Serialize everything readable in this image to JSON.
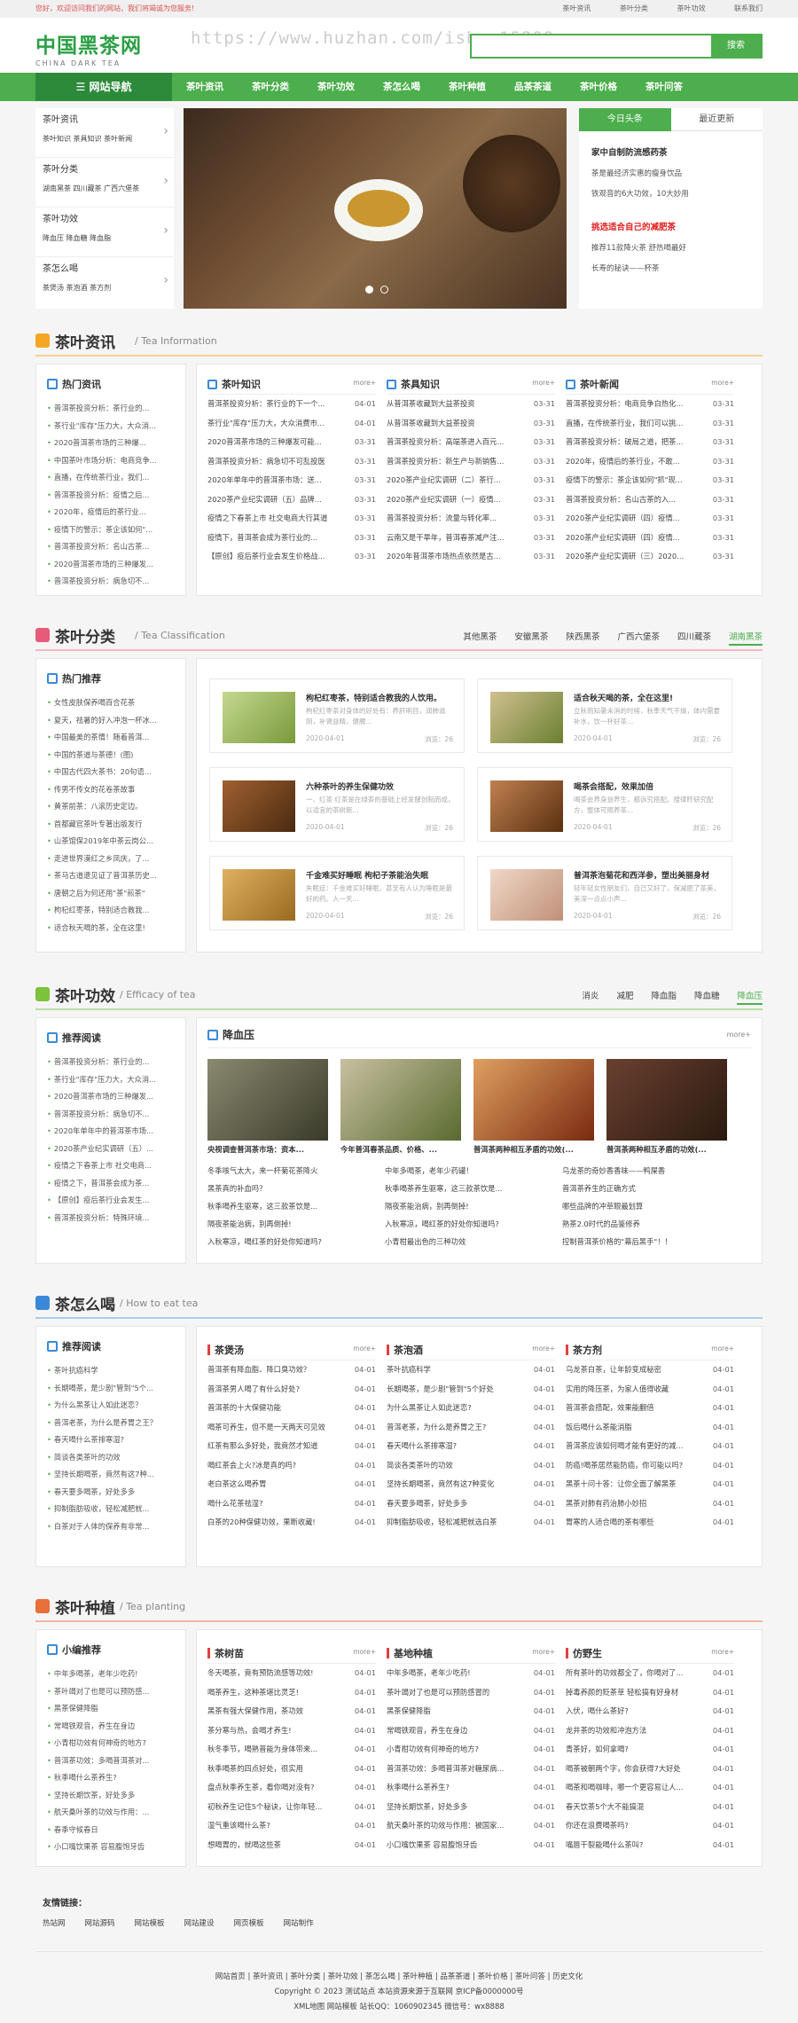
{
  "topbar": {
    "welcome": "您好，欢迎访问我们的网站，我们将竭诚为您服务!",
    "links": [
      "茶叶资讯",
      "茶叶分类",
      "茶叶功效",
      "联系我们"
    ]
  },
  "logo": {
    "title": "中国黑茶网",
    "subtitle": "CHINA DARK TEA"
  },
  "watermark": "https://www.huzhan.com/ishop15299",
  "search": {
    "button": "搜索",
    "placeholder": ""
  },
  "nav": {
    "home": "网站导航",
    "items": [
      "茶叶资讯",
      "茶叶分类",
      "茶叶功效",
      "茶怎么喝",
      "茶叶种植",
      "品茶茶道",
      "茶叶价格",
      "茶叶问答"
    ]
  },
  "categories": [
    {
      "title": "茶叶资讯",
      "sub": "茶叶知识  茶具知识  茶叶新闻"
    },
    {
      "title": "茶叶分类",
      "sub": "湖南黑茶  四川藏茶  广西六堡茶"
    },
    {
      "title": "茶叶功效",
      "sub": "降血压  降血糖  降血脂"
    },
    {
      "title": "茶怎么喝",
      "sub": "茶煲汤  茶泡酒  茶方剂"
    }
  ],
  "newsbox": {
    "tabs": [
      "今日头条",
      "最近更新"
    ],
    "headline1": "家中自制防流感药茶",
    "items1": [
      "茶是最经济实惠的瘦身饮品",
      "铁观音的6大功效，10大妙用"
    ],
    "headline2": "挑选适合自己的减肥茶",
    "items2": [
      "推荐11款降火茶 舒热喝最好",
      "长寿的秘诀——杯茶"
    ]
  },
  "s1": {
    "name": "茶叶资讯",
    "en": "/ Tea Information",
    "side_title": "热门资讯",
    "side": [
      "普洱茶投资分析：茶行业的...",
      "茶行业\"库存\"压力大，大众消...",
      "2020普洱茶市场的三种爆...",
      "中国茶叶市场分析：电商竞争...",
      "直播，在传统茶行业，我们...",
      "普洱茶投资分析：疫情之后...",
      "2020年，疫情后的茶行业...",
      "疫情下的警示：茶企该如何\"...",
      "普洱茶投资分析：名山古茶...",
      "2020普洱茶市场的三种爆发...",
      "普洱茶投资分析：病急切不..."
    ],
    "cols": [
      {
        "title": "茶叶知识",
        "more": "more+",
        "rows": [
          [
            "普洱茶投资分析：茶行业的下一个...",
            "04-01"
          ],
          [
            "茶行业\"库存\"压力大，大众消费市...",
            "04-01"
          ],
          [
            "2020普洱茶市场的三种爆发可能...",
            "03-31"
          ],
          [
            "普洱茶投资分析：病急切不可乱投医",
            "03-31"
          ],
          [
            "2020年单年中的普洱茶市场：送...",
            "03-31"
          ],
          [
            "2020茶产业纪实调研（五）品牌...",
            "03-31"
          ],
          [
            "疫情之下春茶上市 社交电商大行其道",
            "03-31"
          ],
          [
            "疫情下，普洱茶会成为茶行业的...",
            "03-31"
          ],
          [
            "【原创】疫后茶行业会发生价格战...",
            "03-31"
          ]
        ]
      },
      {
        "title": "茶具知识",
        "more": "more+",
        "rows": [
          [
            "从普洱茶收藏到大益茶投资",
            "03-31"
          ],
          [
            "从普洱茶收藏到大益茶投资",
            "03-31"
          ],
          [
            "普洱茶投资分析：高端茶进入百元...",
            "03-31"
          ],
          [
            "普洱茶投资分析：新生产与新销售...",
            "03-31"
          ],
          [
            "2020茶产业纪实调研（二）茶行...",
            "03-31"
          ],
          [
            "2020茶产业纪实调研（一）疫情...",
            "03-31"
          ],
          [
            "普洱茶投资分析：流量与转化率...",
            "03-31"
          ],
          [
            "云南又是干旱年，普洱春茶减产注...",
            "03-31"
          ],
          [
            "2020年普洱茶市场热点依然是古...",
            "03-31"
          ]
        ]
      },
      {
        "title": "茶叶新闻",
        "more": "more+",
        "rows": [
          [
            "普洱茶投资分析：电商竞争白热化...",
            "03-31"
          ],
          [
            "直播，在传统茶行业，我们可以挑...",
            "03-31"
          ],
          [
            "普洱茶投资分析：破局之道，把茶...",
            "03-31"
          ],
          [
            "2020年，疫情后的茶行业，不敢...",
            "03-31"
          ],
          [
            "疫情下的警示：茶企该如何\"抓\"现...",
            "03-31"
          ],
          [
            "普洱茶投资分析：名山古茶的入...",
            "03-31"
          ],
          [
            "2020茶产业纪实调研（四）疫情...",
            "03-31"
          ],
          [
            "2020茶产业纪实调研（四）疫情...",
            "03-31"
          ],
          [
            "2020茶产业纪实调研（三）2020...",
            "03-31"
          ]
        ]
      }
    ]
  },
  "s2": {
    "name": "茶叶分类",
    "en": "/ Tea Classification",
    "tabs": [
      "其他黑茶",
      "安徽黑茶",
      "陕西黑茶",
      "广西六堡茶",
      "四川藏茶",
      "湖南黑茶"
    ],
    "side_title": "热门推荐",
    "side": [
      "女性皮肤保养喝百合花茶",
      "夏天，祛暑的好入冲泡一杯冰...",
      "中国最美的茶情！随着普洱...",
      "中国的茶道与茶德！(图)",
      "中国古代四大茶书：20句语...",
      "传男不传女的花卷茶故事",
      "黄茶前茶：八滚历史定边。",
      "首都藏官茶叶专著出版发行",
      "山茶馆保2019年中茶云岗公...",
      "走进世界漠红之乡凤庆，了...",
      "茶马古道遗见证了普洱茶历史...",
      "唐朝之后为何还用\"茶\"煎茶\"",
      "枸杞红枣茶，特别适合教我...",
      "适合秋天喝的茶，全在这里!"
    ],
    "cards": [
      {
        "title": "枸杞红枣茶，特别适合教我的人饮用。",
        "desc": "枸杞红枣茶对身体的好处有：养肝明目，润肺滋阴，补肾益精，健脾...",
        "date": "2020-04-01",
        "views": "浏览：26"
      },
      {
        "title": "适合秋天喝的茶，全在这里!",
        "desc": "立秋而知暑未消的时候，秋季天气干燥，体内需要补水，饮一杯好茶...",
        "date": "2020-04-01",
        "views": "浏览：26"
      },
      {
        "title": "六种茶叶的养生保健功效",
        "desc": "一、红茶 红茶是在绿茶的基础上经发酵创制而成，以适宜的茶树新...",
        "date": "2020-04-01",
        "views": "浏览：26"
      },
      {
        "title": "喝茶会搭配，效果加倍",
        "desc": "喝茶会养身益养生，都诉究搭配。搜律盱研究配方，整体可照养茶...",
        "date": "2020-04-01",
        "views": "浏览：26"
      },
      {
        "title": "千金难买好睡眠 枸杞子茶能治失眠",
        "desc": "失眠症：千金难买好睡眠，甚至有人认为睡眠是最好的药。人一天...",
        "date": "2020-04-01",
        "views": "浏览：26"
      },
      {
        "title": "普洱茶泡菊花和西洋参，塑出美丽身材",
        "desc": "轻年轻女性朋友们，自己又好了，保减肥了茶美，美深一点点小声...",
        "date": "2020-04-01",
        "views": "浏览：26"
      }
    ]
  },
  "s3": {
    "name": "茶叶功效",
    "en": "/ Efficacy of tea",
    "tabs": [
      "消炎",
      "减肥",
      "降血脂",
      "降血糖",
      "降血压"
    ],
    "side_title": "推荐阅读",
    "side": [
      "普洱茶投资分析：茶行业的...",
      "茶行业\"库存\"压力大，大众消...",
      "2020普洱茶市场的三种爆发...",
      "普洱茶投资分析：病急切不...",
      "2020年单年中的普洱茶市场...",
      "2020茶产业纪实调研（五）...",
      "疫情之下春茶上市 社交电商...",
      "疫情之下，普洱茶会成为茶...",
      "【原创】疫后茶行业会发生...",
      "普洱茶投资分析：特殊环境..."
    ],
    "panel_title": "降血压",
    "more": "more+",
    "pics": [
      "央视调查普洱茶市场：资本...",
      "今年普洱春茶品质、价格、...",
      "普洱茶两种相互矛盾的功效(...",
      "普洱茶两种相互矛盾的功效(..."
    ],
    "links": [
      "冬季咳气太大，来一杯菊花茶降火",
      "中年多喝茶，老年少药罐！",
      "乌龙茶的奇妙香香味——鸭屎香",
      "黑茶真的补血吗？",
      "秋季喝茶养生驱寒，这三款茶饮是...",
      "普洱茶养生的正确方式",
      "秋季喝养生驱寒，这三款茶饮是...",
      "隔夜茶能治病，别再倒掉!",
      "哪些品牌的冲草眼最划算",
      "隔夜茶能治病，别再倒掉!",
      "入秋寒凉，喝红茶的好处你知道吗?",
      "熟茶2.0时代的品鉴修养",
      "入秋寒凉，喝红茶的好处你知道吗?",
      "小青柑最出色的三种功效",
      "控制普洱茶价格的\"幕后黑手\"！！"
    ]
  },
  "s4": {
    "name": "茶怎么喝",
    "en": "/ How to eat tea",
    "side_title": "推荐阅读",
    "side": [
      "茶叶抗癌科学",
      "长期喝茶，是少剧\"管到\"5个...",
      "为什么黑茶让人如此迷恋？",
      "普洱老茶，为什么是养胃之王？",
      "春天喝什么茶排寒湿?",
      "简谈各类茶叶的功效",
      "坚持长期喝茶，竟然有这7种...",
      "春天要多喝茶，好处多多",
      "抑制脂肪吸收，轻松减肥就...",
      "白茶对于人体的保养有非常..."
    ],
    "cols": [
      {
        "title": "茶煲汤",
        "more": "more+",
        "rows": [
          [
            "普洱茶有降血脂、降口臭功效？",
            "04-01"
          ],
          [
            "普洱茶男人喝了有什么好处?",
            "04-01"
          ],
          [
            "普洱茶的十大保健功能",
            "04-01"
          ],
          [
            "喝茶可养生，但不是一天两天可见效",
            "04-01"
          ],
          [
            "红茶有那么多好处，我竟然才知道",
            "04-01"
          ],
          [
            "喝红茶会上火?冰是真的吗?",
            "04-01"
          ],
          [
            "老白茶这么喝养胃",
            "04-01"
          ],
          [
            "喝什么花茶祛湿?",
            "04-01"
          ],
          [
            "白茶的20种保健功效，果断收藏!",
            "04-01"
          ]
        ]
      },
      {
        "title": "茶泡酒",
        "more": "more+",
        "rows": [
          [
            "茶叶抗癌科学",
            "04-01"
          ],
          [
            "长期喝茶，是少剧\"管到\"5个好处",
            "04-01"
          ],
          [
            "为什么黑茶让人如此迷恋?",
            "04-01"
          ],
          [
            "普洱老茶，为什么是养胃之王?",
            "04-01"
          ],
          [
            "春天喝什么茶排寒湿?",
            "04-01"
          ],
          [
            "简谈各类茶叶的功效",
            "04-01"
          ],
          [
            "坚持长期喝茶，竟然有这7种变化",
            "04-01"
          ],
          [
            "春天要多喝茶，好处多多",
            "04-01"
          ],
          [
            "抑制脂肪吸收，轻松减肥就选白茶",
            "04-01"
          ]
        ]
      },
      {
        "title": "茶方剂",
        "more": "more+",
        "rows": [
          [
            "乌龙茶白茶，让年龄变成秘密",
            "04-01"
          ],
          [
            "实用的降压茶，为家人值得收藏",
            "04-01"
          ],
          [
            "普洱茶会搭配，效果能翻倍",
            "04-01"
          ],
          [
            "饭后喝什么茶能消脂",
            "04-01"
          ],
          [
            "普洱茶应该如何喝才能有更好的减...",
            "04-01"
          ],
          [
            "防癌!喝茶居然能防癌，你可能以吗?",
            "04-01"
          ],
          [
            "黑茶十问十答：让你全面了解黑茶",
            "04-01"
          ],
          [
            "黑茶对肺有药治肺小妙招",
            "04-01"
          ],
          [
            "胃寒的人适合喝的茶有哪些",
            "04-01"
          ]
        ]
      }
    ]
  },
  "s5": {
    "name": "茶叶种植",
    "en": "/ Tea planting",
    "side_title": "小编推荐",
    "side": [
      "中年多喝茶，老年少吃药!",
      "茶叶竭对了也是可以预防感...",
      "黑茶保健降脂",
      "常喝铁观音，养生在身边",
      "小青柑功效有何神奇的地方?",
      "普洱茶功效：多喝普洱茶对...",
      "秋季喝什么茶养生?",
      "坚持长期饮茶，好处多多",
      "航天桑叶茶的功效与作用：...",
      "春季守候春日",
      "小口嘴饮果茶 容易腹饱牙齿"
    ],
    "cols": [
      {
        "title": "茶树苗",
        "more": "more+",
        "rows": [
          [
            "冬天喝茶，竟有预防流感等功效!",
            "04-01"
          ],
          [
            "喝茶养生，这种茶堪比灵芝!",
            "04-01"
          ],
          [
            "黑茶有强大保健作用，茶功效",
            "04-01"
          ],
          [
            "茶分寒与热，会喝才养生!",
            "04-01"
          ],
          [
            "秋冬季节，喝熟普能为身体带来...",
            "04-01"
          ],
          [
            "秋季喝茶的四点好处，很实用",
            "04-01"
          ],
          [
            "盘点秋季养生茶，看你喝对没有?",
            "04-01"
          ],
          [
            "初秋养生记住5个秘诀，让你年轻...",
            "04-01"
          ],
          [
            "湿气重该喝什么茶?",
            "04-01"
          ],
          [
            "想喝胃的，就喝这些茶",
            "04-01"
          ]
        ]
      },
      {
        "title": "基地种植",
        "more": "more+",
        "rows": [
          [
            "中年多喝茶，老年少吃药!",
            "04-01"
          ],
          [
            "茶叶竭对了也是可以预防感冒的",
            "04-01"
          ],
          [
            "黑茶保健降脂",
            "04-01"
          ],
          [
            "常喝铁观音，养生在身边",
            "04-01"
          ],
          [
            "小青柑功效有何神奇的地方?",
            "04-01"
          ],
          [
            "普洱茶功效：多喝普洱茶对糖尿病...",
            "04-01"
          ],
          [
            "秋季喝什么茶养生?",
            "04-01"
          ],
          [
            "坚持长期饮茶，好处多多",
            "04-01"
          ],
          [
            "航天桑叶茶的功效与作用：被国家...",
            "04-01"
          ],
          [
            "小口嘴饮果茶 容易腹饱牙齿",
            "04-01"
          ]
        ]
      },
      {
        "title": "仿野生",
        "more": "more+",
        "rows": [
          [
            "所有茶叶的功效都全了，你喝对了...",
            "04-01"
          ],
          [
            "掉毒养颜的贬茶草 轻松搞有好身材",
            "04-01"
          ],
          [
            "入伏，喝什么茶好?",
            "04-01"
          ],
          [
            "龙井茶的功效和冲泡方法",
            "04-01"
          ],
          [
            "青茶好，如何拿喝?",
            "04-01"
          ],
          [
            "喝茶被朝两个字，你会获得7大好处",
            "04-01"
          ],
          [
            "喝茶和喝咖啡，哪一个更容易让人...",
            "04-01"
          ],
          [
            "春天饮茶5个大不能搞混",
            "04-01"
          ],
          [
            "你还在浪费喝茶吗?",
            "04-01"
          ],
          [
            "嘴唇干裂能喝什么茶叫?",
            "04-01"
          ]
        ]
      }
    ]
  },
  "friend": {
    "title": "友情链接：",
    "links": [
      "热站网",
      "网站源码",
      "网站模板",
      "网站建设",
      "网页模板",
      "网站制作"
    ]
  },
  "footer": {
    "links": "网站首页 | 茶叶资讯 | 茶叶分类 | 茶叶功效 | 茶怎么喝 | 茶叶种植 | 品茶茶道 | 茶叶价格 | 茶叶问答 | 历史文化",
    "copyright": "Copyright © 2023 测试站点 本站资源来源于互联网  京ICP备0000000号",
    "contact": "XML地图 网站模板 站长QQ：1060902345 微信号：wx8888"
  },
  "colors": {
    "green": "#4cae4c",
    "darkgreen": "#2e8a3b",
    "red": "#e02020"
  }
}
